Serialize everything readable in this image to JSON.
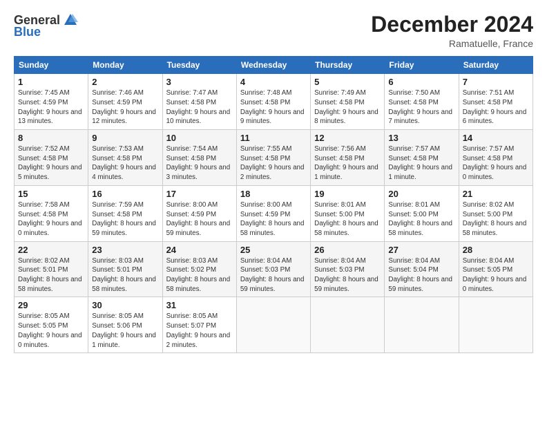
{
  "logo": {
    "general": "General",
    "blue": "Blue"
  },
  "title": "December 2024",
  "subtitle": "Ramatuelle, France",
  "headers": [
    "Sunday",
    "Monday",
    "Tuesday",
    "Wednesday",
    "Thursday",
    "Friday",
    "Saturday"
  ],
  "weeks": [
    [
      {
        "day": "1",
        "sunrise": "Sunrise: 7:45 AM",
        "sunset": "Sunset: 4:59 PM",
        "daylight": "Daylight: 9 hours and 13 minutes."
      },
      {
        "day": "2",
        "sunrise": "Sunrise: 7:46 AM",
        "sunset": "Sunset: 4:59 PM",
        "daylight": "Daylight: 9 hours and 12 minutes."
      },
      {
        "day": "3",
        "sunrise": "Sunrise: 7:47 AM",
        "sunset": "Sunset: 4:58 PM",
        "daylight": "Daylight: 9 hours and 10 minutes."
      },
      {
        "day": "4",
        "sunrise": "Sunrise: 7:48 AM",
        "sunset": "Sunset: 4:58 PM",
        "daylight": "Daylight: 9 hours and 9 minutes."
      },
      {
        "day": "5",
        "sunrise": "Sunrise: 7:49 AM",
        "sunset": "Sunset: 4:58 PM",
        "daylight": "Daylight: 9 hours and 8 minutes."
      },
      {
        "day": "6",
        "sunrise": "Sunrise: 7:50 AM",
        "sunset": "Sunset: 4:58 PM",
        "daylight": "Daylight: 9 hours and 7 minutes."
      },
      {
        "day": "7",
        "sunrise": "Sunrise: 7:51 AM",
        "sunset": "Sunset: 4:58 PM",
        "daylight": "Daylight: 9 hours and 6 minutes."
      }
    ],
    [
      {
        "day": "8",
        "sunrise": "Sunrise: 7:52 AM",
        "sunset": "Sunset: 4:58 PM",
        "daylight": "Daylight: 9 hours and 5 minutes."
      },
      {
        "day": "9",
        "sunrise": "Sunrise: 7:53 AM",
        "sunset": "Sunset: 4:58 PM",
        "daylight": "Daylight: 9 hours and 4 minutes."
      },
      {
        "day": "10",
        "sunrise": "Sunrise: 7:54 AM",
        "sunset": "Sunset: 4:58 PM",
        "daylight": "Daylight: 9 hours and 3 minutes."
      },
      {
        "day": "11",
        "sunrise": "Sunrise: 7:55 AM",
        "sunset": "Sunset: 4:58 PM",
        "daylight": "Daylight: 9 hours and 2 minutes."
      },
      {
        "day": "12",
        "sunrise": "Sunrise: 7:56 AM",
        "sunset": "Sunset: 4:58 PM",
        "daylight": "Daylight: 9 hours and 1 minute."
      },
      {
        "day": "13",
        "sunrise": "Sunrise: 7:57 AM",
        "sunset": "Sunset: 4:58 PM",
        "daylight": "Daylight: 9 hours and 1 minute."
      },
      {
        "day": "14",
        "sunrise": "Sunrise: 7:57 AM",
        "sunset": "Sunset: 4:58 PM",
        "daylight": "Daylight: 9 hours and 0 minutes."
      }
    ],
    [
      {
        "day": "15",
        "sunrise": "Sunrise: 7:58 AM",
        "sunset": "Sunset: 4:58 PM",
        "daylight": "Daylight: 9 hours and 0 minutes."
      },
      {
        "day": "16",
        "sunrise": "Sunrise: 7:59 AM",
        "sunset": "Sunset: 4:58 PM",
        "daylight": "Daylight: 8 hours and 59 minutes."
      },
      {
        "day": "17",
        "sunrise": "Sunrise: 8:00 AM",
        "sunset": "Sunset: 4:59 PM",
        "daylight": "Daylight: 8 hours and 59 minutes."
      },
      {
        "day": "18",
        "sunrise": "Sunrise: 8:00 AM",
        "sunset": "Sunset: 4:59 PM",
        "daylight": "Daylight: 8 hours and 58 minutes."
      },
      {
        "day": "19",
        "sunrise": "Sunrise: 8:01 AM",
        "sunset": "Sunset: 5:00 PM",
        "daylight": "Daylight: 8 hours and 58 minutes."
      },
      {
        "day": "20",
        "sunrise": "Sunrise: 8:01 AM",
        "sunset": "Sunset: 5:00 PM",
        "daylight": "Daylight: 8 hours and 58 minutes."
      },
      {
        "day": "21",
        "sunrise": "Sunrise: 8:02 AM",
        "sunset": "Sunset: 5:00 PM",
        "daylight": "Daylight: 8 hours and 58 minutes."
      }
    ],
    [
      {
        "day": "22",
        "sunrise": "Sunrise: 8:02 AM",
        "sunset": "Sunset: 5:01 PM",
        "daylight": "Daylight: 8 hours and 58 minutes."
      },
      {
        "day": "23",
        "sunrise": "Sunrise: 8:03 AM",
        "sunset": "Sunset: 5:01 PM",
        "daylight": "Daylight: 8 hours and 58 minutes."
      },
      {
        "day": "24",
        "sunrise": "Sunrise: 8:03 AM",
        "sunset": "Sunset: 5:02 PM",
        "daylight": "Daylight: 8 hours and 58 minutes."
      },
      {
        "day": "25",
        "sunrise": "Sunrise: 8:04 AM",
        "sunset": "Sunset: 5:03 PM",
        "daylight": "Daylight: 8 hours and 59 minutes."
      },
      {
        "day": "26",
        "sunrise": "Sunrise: 8:04 AM",
        "sunset": "Sunset: 5:03 PM",
        "daylight": "Daylight: 8 hours and 59 minutes."
      },
      {
        "day": "27",
        "sunrise": "Sunrise: 8:04 AM",
        "sunset": "Sunset: 5:04 PM",
        "daylight": "Daylight: 8 hours and 59 minutes."
      },
      {
        "day": "28",
        "sunrise": "Sunrise: 8:04 AM",
        "sunset": "Sunset: 5:05 PM",
        "daylight": "Daylight: 9 hours and 0 minutes."
      }
    ],
    [
      {
        "day": "29",
        "sunrise": "Sunrise: 8:05 AM",
        "sunset": "Sunset: 5:05 PM",
        "daylight": "Daylight: 9 hours and 0 minutes."
      },
      {
        "day": "30",
        "sunrise": "Sunrise: 8:05 AM",
        "sunset": "Sunset: 5:06 PM",
        "daylight": "Daylight: 9 hours and 1 minute."
      },
      {
        "day": "31",
        "sunrise": "Sunrise: 8:05 AM",
        "sunset": "Sunset: 5:07 PM",
        "daylight": "Daylight: 9 hours and 2 minutes."
      },
      null,
      null,
      null,
      null
    ]
  ]
}
